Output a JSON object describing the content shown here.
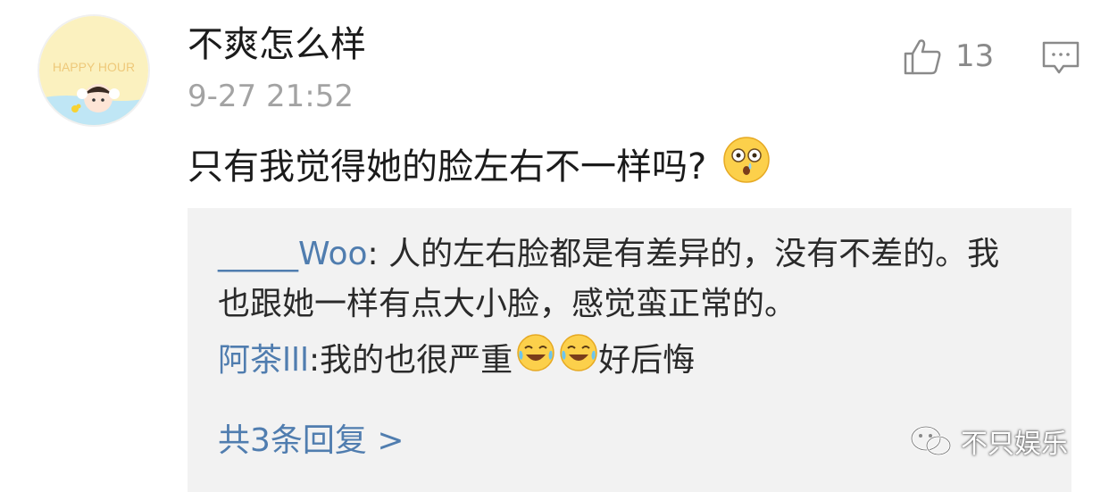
{
  "comment": {
    "avatar_text": "HAPPY HOUR",
    "username": "不爽怎么样",
    "timestamp": "9-27 21:52",
    "like_count": "13",
    "text": "只有我觉得她的脸左右不一样吗?",
    "emoji": "astonished-crying-face"
  },
  "replies": [
    {
      "author": "_____Woo",
      "separator": ": ",
      "text": "人的左右脸都是有差异的，没有不差的。我也跟她一样有点大小脸，感觉蛮正常的。"
    },
    {
      "author": "阿茶lll",
      "separator": ": ",
      "text_before": "我的也很严重",
      "emojis": [
        "laugh-cry-face",
        "laugh-cry-face"
      ],
      "text_after": "好后悔"
    }
  ],
  "more_replies_label": "共3条回复 >",
  "watermark": "不只娱乐",
  "colors": {
    "link": "#507daf",
    "reply_bg": "#f2f2f2",
    "muted": "#a3a3a3"
  }
}
